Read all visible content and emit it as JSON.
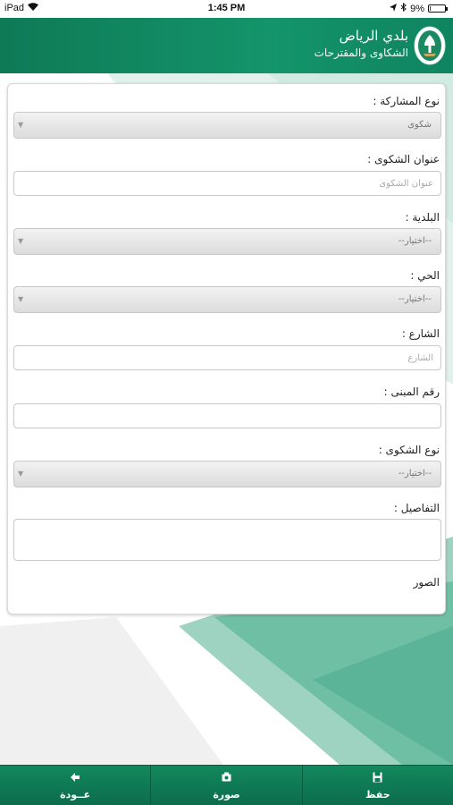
{
  "status_bar": {
    "device": "iPad",
    "time": "1:45 PM",
    "battery": "9%",
    "battery_level": 0.09
  },
  "header": {
    "app_title": "بلدي الرياض",
    "page_title": "الشكاوى والمقترحات",
    "logo_icon": "riyadh-municipality-emblem"
  },
  "form": {
    "participation_type": {
      "label": "نوع المشاركة :",
      "value": "شكوى"
    },
    "complaint_title": {
      "label": "عنوان الشكوى :",
      "placeholder": "عنوان الشكوى"
    },
    "municipality": {
      "label": "البلدية :",
      "value": "--اختيار--"
    },
    "district": {
      "label": "الحي :",
      "value": "--اختيار--"
    },
    "street": {
      "label": "الشارع :",
      "placeholder": "الشارع"
    },
    "building_number": {
      "label": "رقم المبنى :",
      "value": ""
    },
    "complaint_type": {
      "label": "نوع الشكوى :",
      "value": "--اختيار--"
    },
    "details": {
      "label": "التفاصيل :",
      "value": ""
    },
    "photos_label": "الصور"
  },
  "toolbar": {
    "back": {
      "label": "عــودة",
      "icon": "arrow-left-icon"
    },
    "photo": {
      "label": "صورة",
      "icon": "camera-icon"
    },
    "save": {
      "label": "حفظ",
      "icon": "floppy-disk-icon"
    }
  },
  "colors": {
    "primary": "#0f8460",
    "toolbar": "#0c6c4b",
    "background_tint": "#bfe3d6"
  }
}
